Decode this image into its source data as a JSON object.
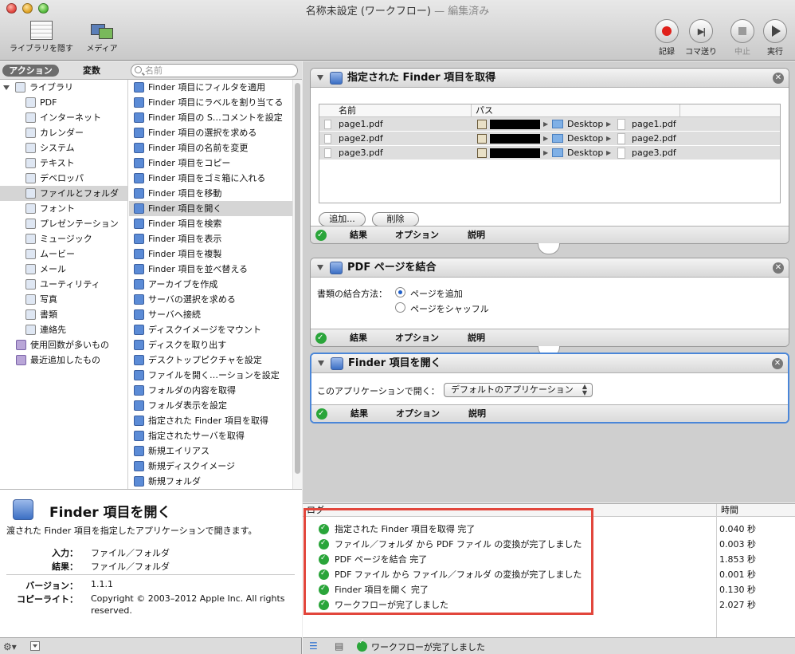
{
  "window": {
    "title": "名称未設定 (ワークフロー)",
    "edited": " — 編集済み"
  },
  "toolbar": {
    "hide_library": "ライブラリを隠す",
    "media": "メディア",
    "record": "記録",
    "step": "コマ送り",
    "stop": "中止",
    "run": "実行"
  },
  "library": {
    "tab_actions": "アクション",
    "tab_variables": "変数",
    "search_placeholder": "名前",
    "root": "ライブラリ",
    "categories": [
      "PDF",
      "インターネット",
      "カレンダー",
      "システム",
      "テキスト",
      "デベロッパ",
      "ファイルとフォルダ",
      "フォント",
      "プレゼンテーション",
      "ミュージック",
      "ムービー",
      "メール",
      "ユーティリティ",
      "写真",
      "書類",
      "連絡先"
    ],
    "selected_category": 6,
    "top_items": [
      "使用回数が多いもの",
      "最近追加したもの"
    ],
    "actions": [
      "Finder 項目にフィルタを適用",
      "Finder 項目にラベルを割り当てる",
      "Finder 項目の S…コメントを設定",
      "Finder 項目の選択を求める",
      "Finder 項目の名前を変更",
      "Finder 項目をコピー",
      "Finder 項目をゴミ箱に入れる",
      "Finder 項目を移動",
      "Finder 項目を開く",
      "Finder 項目を検索",
      "Finder 項目を表示",
      "Finder 項目を複製",
      "Finder 項目を並べ替える",
      "アーカイブを作成",
      "サーバの選択を求める",
      "サーバへ接続",
      "ディスクイメージをマウント",
      "ディスクを取り出す",
      "デスクトップピクチャを設定",
      "ファイルを開く…ーションを設定",
      "フォルダの内容を取得",
      "フォルダ表示を設定",
      "指定された Finder 項目を取得",
      "指定されたサーバを取得",
      "新規エイリアス",
      "新規ディスクイメージ",
      "新規フォルダ"
    ],
    "selected_action": 8
  },
  "description": {
    "title": "Finder 項目を開く",
    "text": "渡された Finder 項目を指定したアプリケーションで開きます。",
    "input_label": "入力：",
    "input_value": "ファイル／フォルダ",
    "result_label": "結果：",
    "result_value": "ファイル／フォルダ",
    "version_label": "バージョン：",
    "version_value": "1.1.1",
    "copyright_label": "コピーライト：",
    "copyright_value": "Copyright © 2003–2012 Apple Inc.  All rights reserved."
  },
  "workflow": {
    "footer": {
      "results": "結果",
      "options": "オプション",
      "description": "説明"
    },
    "card1": {
      "title": "指定された Finder 項目を取得",
      "col_name": "名前",
      "col_path": "パス",
      "rows": [
        {
          "name": "page1.pdf",
          "folder": "Desktop",
          "file": "page1.pdf"
        },
        {
          "name": "page2.pdf",
          "folder": "Desktop",
          "file": "page2.pdf"
        },
        {
          "name": "page3.pdf",
          "folder": "Desktop",
          "file": "page3.pdf"
        }
      ],
      "add_button": "追加...",
      "remove_button": "削除"
    },
    "card2": {
      "title": "PDF ページを結合",
      "method_label": "書類の結合方法：",
      "option_append": "ページを追加",
      "option_shuffle": "ページをシャッフル"
    },
    "card3": {
      "title": "Finder 項目を開く",
      "open_with_label": "このアプリケーションで開く：",
      "app_value": "デフォルトのアプリケーション"
    }
  },
  "log": {
    "col_log": "ログ",
    "col_time": "時間",
    "rows": [
      {
        "msg": "指定された Finder 項目を取得 完了",
        "time": "0.040 秒"
      },
      {
        "msg": "ファイル／フォルダ から PDF ファイル の変換が完了しました",
        "time": "0.003 秒"
      },
      {
        "msg": "PDF ページを結合 完了",
        "time": "1.853 秒"
      },
      {
        "msg": "PDF ファイル から ファイル／フォルダ の変換が完了しました",
        "time": "0.001 秒"
      },
      {
        "msg": "Finder 項目を開く 完了",
        "time": "0.130 秒"
      },
      {
        "msg": "ワークフローが完了しました",
        "time": "2.027 秒"
      }
    ]
  },
  "status": {
    "text": "ワークフローが完了しました"
  }
}
